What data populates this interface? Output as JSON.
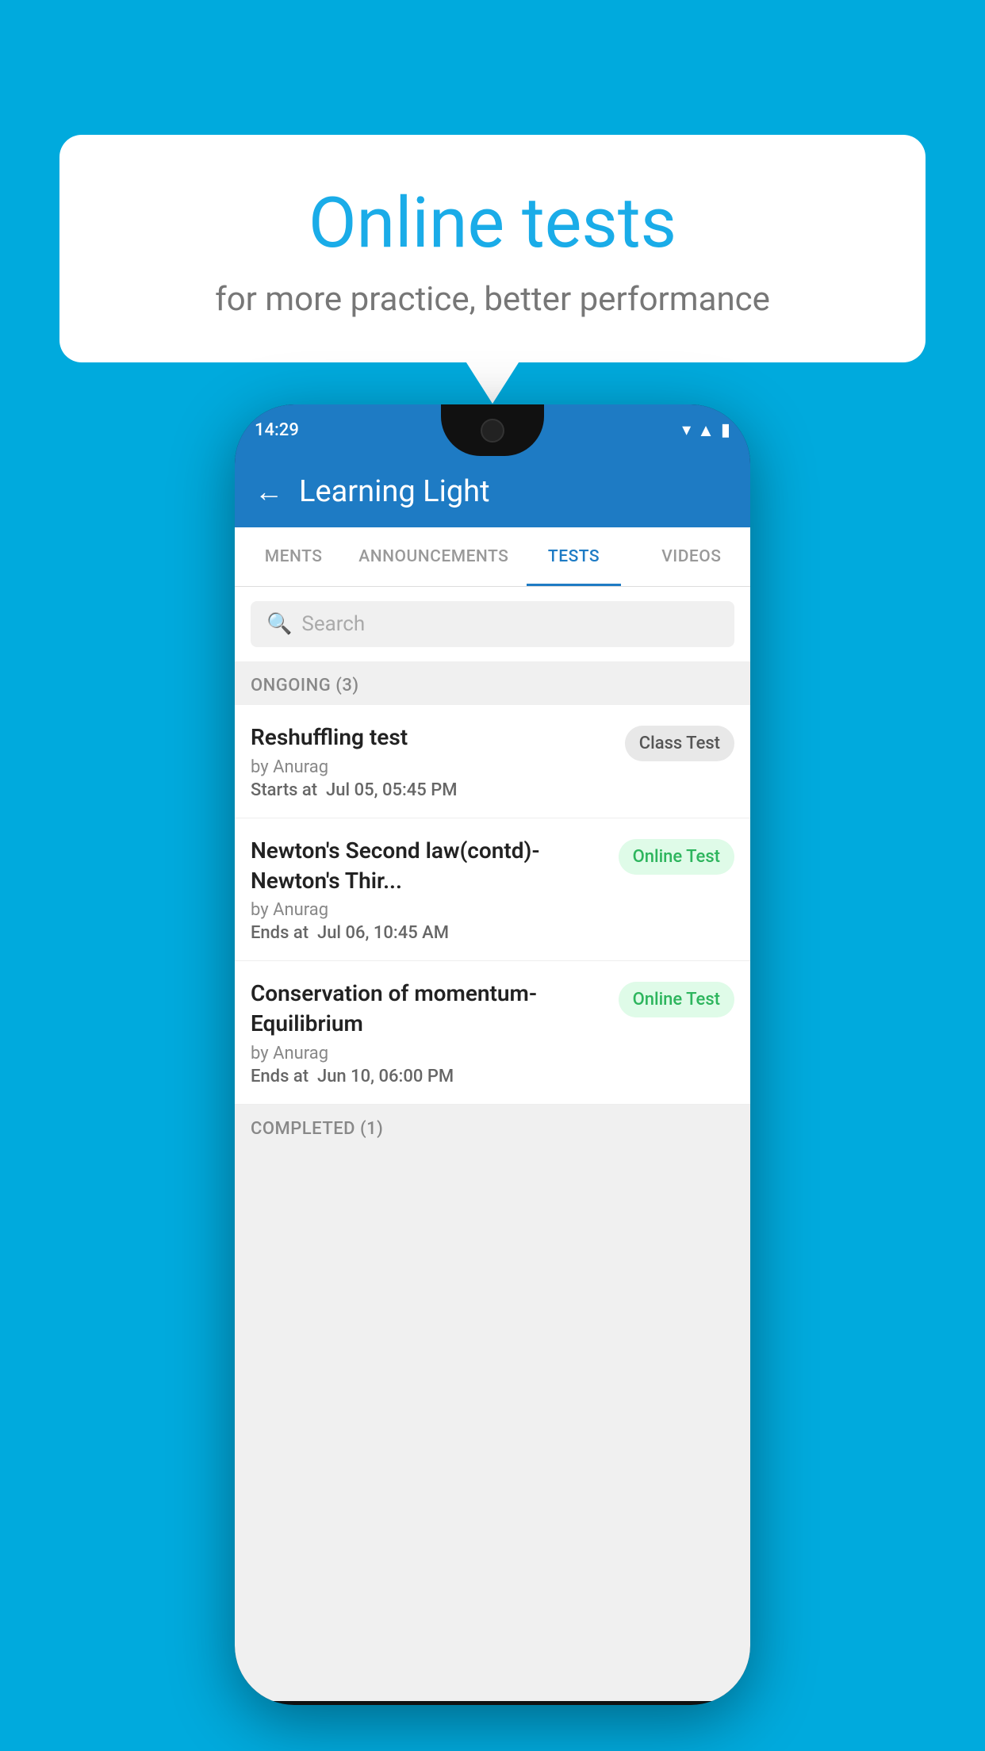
{
  "background_color": "#00AADD",
  "speech_bubble": {
    "title": "Online tests",
    "subtitle": "for more practice, better performance"
  },
  "phone": {
    "status_bar": {
      "time": "14:29",
      "icons": [
        "wifi",
        "signal",
        "battery"
      ]
    },
    "app_bar": {
      "back_label": "←",
      "title": "Learning Light"
    },
    "tabs": [
      {
        "label": "MENTS",
        "active": false
      },
      {
        "label": "ANNOUNCEMENTS",
        "active": false
      },
      {
        "label": "TESTS",
        "active": true
      },
      {
        "label": "VIDEOS",
        "active": false
      }
    ],
    "search": {
      "placeholder": "Search"
    },
    "ongoing_section": {
      "header": "ONGOING (3)",
      "items": [
        {
          "name": "Reshuffling test",
          "by": "by Anurag",
          "time_label": "Starts at",
          "time_value": "Jul 05, 05:45 PM",
          "badge": "Class Test",
          "badge_type": "class"
        },
        {
          "name": "Newton's Second law(contd)-Newton's Thir...",
          "by": "by Anurag",
          "time_label": "Ends at",
          "time_value": "Jul 06, 10:45 AM",
          "badge": "Online Test",
          "badge_type": "online"
        },
        {
          "name": "Conservation of momentum-Equilibrium",
          "by": "by Anurag",
          "time_label": "Ends at",
          "time_value": "Jun 10, 06:00 PM",
          "badge": "Online Test",
          "badge_type": "online"
        }
      ]
    },
    "completed_section": {
      "header": "COMPLETED (1)"
    }
  }
}
